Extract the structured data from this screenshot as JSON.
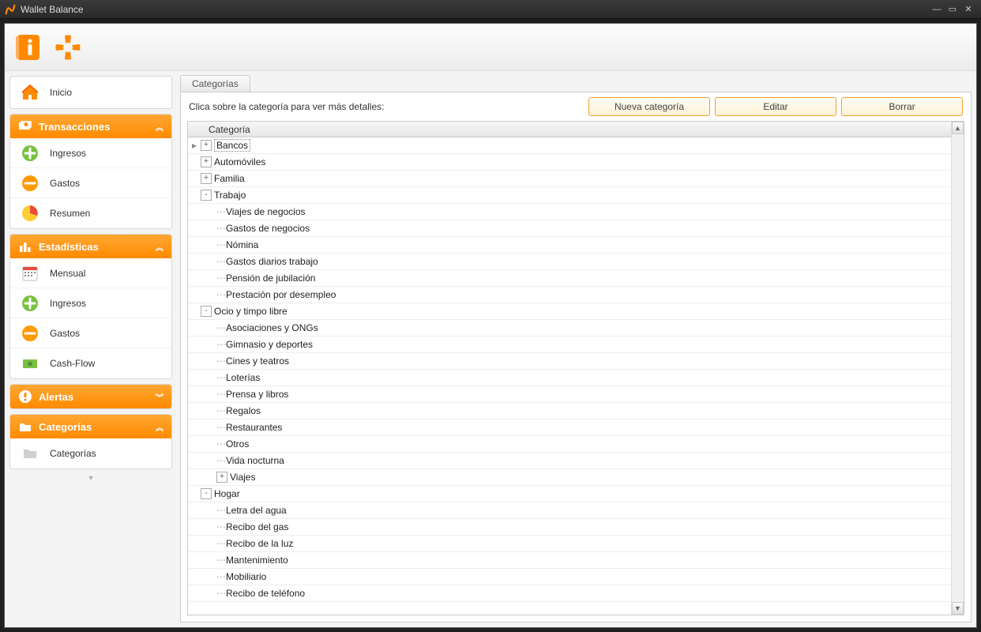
{
  "window": {
    "title": "Wallet Balance"
  },
  "sidebar": {
    "home": {
      "label": "Inicio"
    },
    "transacciones": {
      "header": "Transacciones",
      "items": [
        {
          "label": "Ingresos"
        },
        {
          "label": "Gastos"
        },
        {
          "label": "Resumen"
        }
      ]
    },
    "estadisticas": {
      "header": "Estadísticas",
      "items": [
        {
          "label": "Mensual"
        },
        {
          "label": "Ingresos"
        },
        {
          "label": "Gastos"
        },
        {
          "label": "Cash-Flow"
        }
      ]
    },
    "alertas": {
      "header": "Alertas"
    },
    "categorias": {
      "header": "Categorías",
      "items": [
        {
          "label": "Categorías"
        }
      ]
    }
  },
  "content": {
    "title": "Categorías",
    "hint": "Clica sobre la categoría para ver más detalles:",
    "buttons": {
      "new": "Nueva categoría",
      "edit": "Editar",
      "delete": "Borrar"
    },
    "columnHeader": "Categoría",
    "tree": [
      {
        "label": "Bancos",
        "depth": 0,
        "exp": "+",
        "selected": true,
        "pointer": true
      },
      {
        "label": "Automóviles",
        "depth": 0,
        "exp": "+"
      },
      {
        "label": "Familia",
        "depth": 0,
        "exp": "+"
      },
      {
        "label": "Trabajo",
        "depth": 0,
        "exp": "-"
      },
      {
        "label": "Viajes de negocios",
        "depth": 1
      },
      {
        "label": "Gastos de negocios",
        "depth": 1
      },
      {
        "label": "Nómina",
        "depth": 1
      },
      {
        "label": "Gastos diarios trabajo",
        "depth": 1
      },
      {
        "label": "Pensión de jubilación",
        "depth": 1
      },
      {
        "label": "Prestación por desempleo",
        "depth": 1
      },
      {
        "label": "Ocio y timpo libre",
        "depth": 0,
        "exp": "-"
      },
      {
        "label": "Asociaciones y ONGs",
        "depth": 1
      },
      {
        "label": "Gimnasio y deportes",
        "depth": 1
      },
      {
        "label": "Cines y teatros",
        "depth": 1
      },
      {
        "label": "Loterías",
        "depth": 1
      },
      {
        "label": "Prensa y libros",
        "depth": 1
      },
      {
        "label": "Regalos",
        "depth": 1
      },
      {
        "label": "Restaurantes",
        "depth": 1
      },
      {
        "label": "Otros",
        "depth": 1
      },
      {
        "label": "Vida nocturna",
        "depth": 1
      },
      {
        "label": "Viajes",
        "depth": 1,
        "exp": "+"
      },
      {
        "label": "Hogar",
        "depth": 0,
        "exp": "-"
      },
      {
        "label": "Letra del agua",
        "depth": 1
      },
      {
        "label": "Recibo del gas",
        "depth": 1
      },
      {
        "label": "Recibo de la luz",
        "depth": 1
      },
      {
        "label": "Mantenimiento",
        "depth": 1
      },
      {
        "label": "Mobiliario",
        "depth": 1
      },
      {
        "label": "Recibo de teléfono",
        "depth": 1
      }
    ]
  }
}
